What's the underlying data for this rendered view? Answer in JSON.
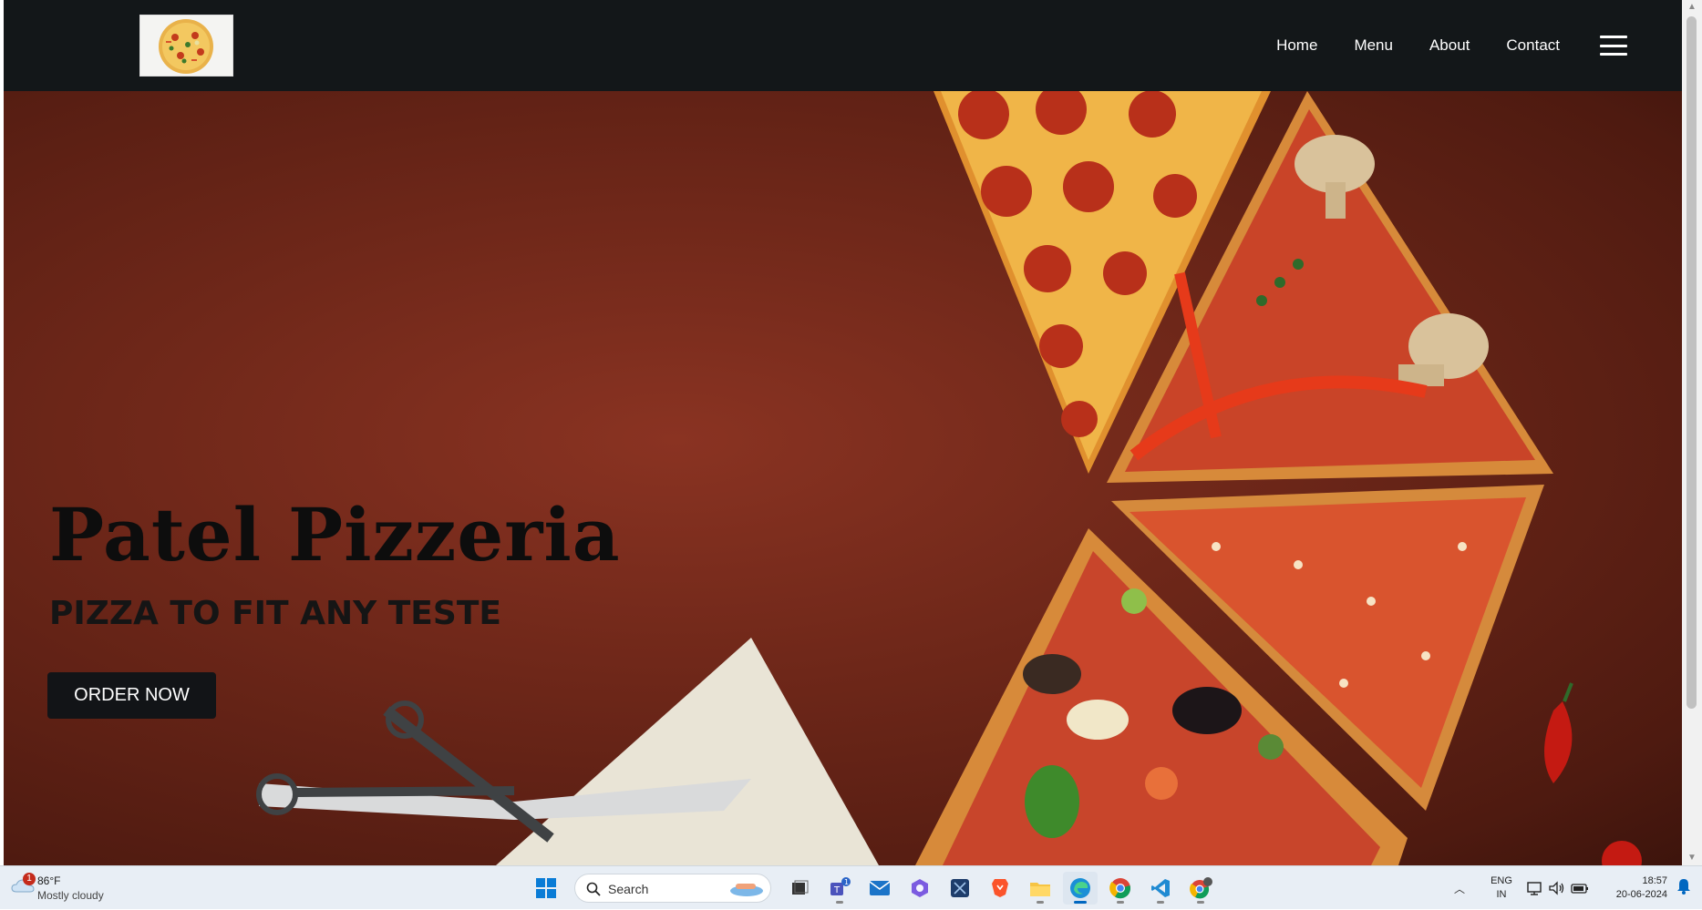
{
  "nav": {
    "logo_alt": "pizza logo",
    "links": [
      "Home",
      "Menu",
      "About",
      "Contact"
    ]
  },
  "hero": {
    "title": "Patel Pizzeria",
    "subtitle": "PIZZA TO FIT ANY TESTE",
    "cta": "ORDER NOW"
  },
  "taskbar": {
    "weather": {
      "badge": "1",
      "temp": "86°F",
      "desc": "Mostly cloudy"
    },
    "search_placeholder": "Search",
    "apps": [
      "windows-start",
      "task-view",
      "teams",
      "mail",
      "copilot",
      "snipping",
      "brave",
      "file-explorer",
      "edge",
      "chrome",
      "vscode",
      "chrome-profile"
    ],
    "teams_badge": "1",
    "lang_line1": "ENG",
    "lang_line2": "IN",
    "time": "18:57",
    "date": "20-06-2024"
  },
  "colors": {
    "navbar_bg": "#131719",
    "hero_bg": "#6e2719",
    "button_bg": "#121417",
    "taskbar_bg": "#e8eef5",
    "accent": "#0067c0"
  }
}
